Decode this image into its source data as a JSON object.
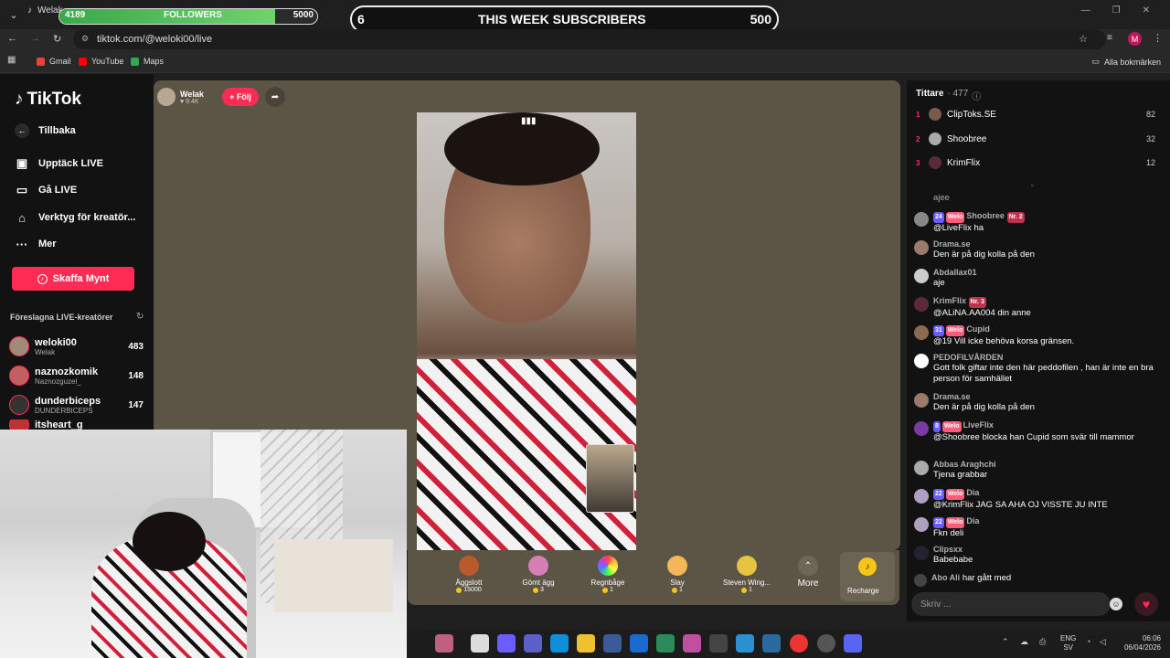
{
  "browser": {
    "tab_title": "Welak",
    "url": "tiktok.com/@weloki00/live",
    "bookmarks": [
      {
        "label": "Gmail",
        "color": "#ea4335"
      },
      {
        "label": "YouTube",
        "color": "#ff0000"
      },
      {
        "label": "Maps",
        "color": "#34a853"
      }
    ],
    "all_bookmarks": "Alla bokmärken",
    "profile_initial": "M"
  },
  "overlay": {
    "followers": {
      "current": "4189",
      "label": "FOLLOWERS",
      "goal": "5000",
      "progress": 0.838
    },
    "subscribers": {
      "current": "6",
      "label": "THIS WEEK SUBSCRIBERS",
      "goal": "500"
    }
  },
  "sidebar": {
    "logo": "TikTok",
    "back": "Tillbaka",
    "nav": [
      {
        "label": "Upptäck LIVE",
        "icon": "live-tv-icon"
      },
      {
        "label": "Gå LIVE",
        "icon": "camera-icon"
      },
      {
        "label": "Verktyg för kreatör...",
        "icon": "home-tools-icon"
      },
      {
        "label": "Mer",
        "icon": "more-icon"
      }
    ],
    "coins_button": "Skaffa Mynt",
    "suggested_title": "Föreslagna LIVE-kreatörer",
    "creators": [
      {
        "name": "weloki00",
        "sub": "Welak",
        "count": "483"
      },
      {
        "name": "naznozkomik",
        "sub": "Naznozguzel_",
        "count": "148"
      },
      {
        "name": "dunderbiceps",
        "sub": "DUNDERBICEPS",
        "count": "147"
      },
      {
        "name": "itsheart_g",
        "sub": "",
        "count": ""
      }
    ]
  },
  "host": {
    "name": "Welak",
    "likes": "9.4K",
    "follow": "+ Följ"
  },
  "gifts": [
    {
      "name": "Äggslott",
      "price": "15000",
      "color": "#b85a2e"
    },
    {
      "name": "Gömt ägg",
      "price": "3",
      "color": "#d67fb7"
    },
    {
      "name": "Regnbåge",
      "price": "1",
      "color": "#e8c46a"
    },
    {
      "name": "Slay",
      "price": "1",
      "color": "#f4b65a"
    },
    {
      "name": "Steven Wing...",
      "price": "1",
      "color": "#e5c440"
    }
  ],
  "gift_more": "More",
  "recharge": "Recharge",
  "chat": {
    "viewers_label": "Tittare",
    "viewers_count": "· 477",
    "top_viewers": [
      {
        "rank": "1",
        "name": "ClipToks.SE",
        "score": "82"
      },
      {
        "rank": "2",
        "name": "Shoobree",
        "score": "32"
      },
      {
        "rank": "3",
        "name": "KrimFlix",
        "score": "12"
      }
    ],
    "messages": [
      {
        "user": "",
        "text": "ajee",
        "badges": []
      },
      {
        "user": "Shoobree",
        "text": "@LiveFlix ha",
        "badges": [
          "24",
          "Welo",
          "Nr. 2"
        ]
      },
      {
        "user": "Drama.se",
        "text": "Den är på dig kolla på den",
        "badges": []
      },
      {
        "user": "Abdallax01",
        "text": "aje",
        "badges": []
      },
      {
        "user": "KrimFlix",
        "text": "@ALiNA.AA004 din anne",
        "badges": [
          "Nr. 3"
        ]
      },
      {
        "user": "Cupid",
        "text": "@19 Vill icke behöva korsa gränsen.",
        "badges": [
          "31",
          "Welo"
        ]
      },
      {
        "user": "PEDOFILVÅRDEN",
        "text": "Gott folk giftar inte den här peddofilen , han är inte en bra person för samhället",
        "badges": []
      },
      {
        "user": "Drama.se",
        "text": "Den är på dig kolla på den",
        "badges": []
      },
      {
        "user": "LiveFlix",
        "text": "@Shoobree  blocka han Cupid som svär till mammor",
        "badges": [
          "8",
          "Welo"
        ]
      },
      {
        "user": "Abbas Araghchi",
        "text": "Tjena grabbar",
        "badges": []
      },
      {
        "user": "Dia",
        "text": "@KrimFlix  JAG SA AHA OJ VISSTE JU INTE",
        "badges": [
          "22",
          "Welo"
        ]
      },
      {
        "user": "Dia",
        "text": "Fkn deli",
        "badges": [
          "22",
          "Welo"
        ]
      },
      {
        "user": "Clipsxx",
        "text": "Babebabe",
        "badges": []
      }
    ],
    "join_user": "Abo Ali",
    "join_text": "har gått med",
    "input_placeholder": "Skriv ..."
  },
  "taskbar": {
    "lang": "ENG",
    "region": "SV",
    "time": "06:06",
    "date": "06/04/2026"
  }
}
